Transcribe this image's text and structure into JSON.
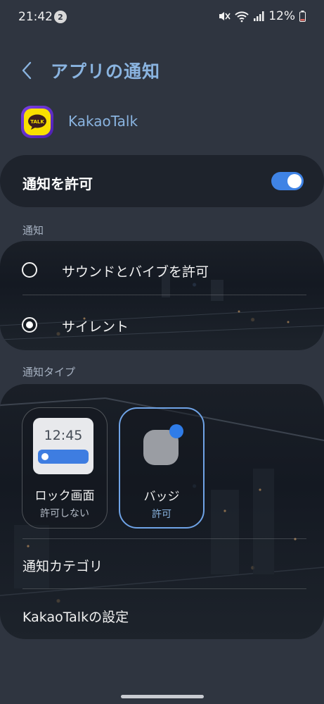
{
  "status_bar": {
    "time": "21:42",
    "notification_count": "2",
    "battery": "12%"
  },
  "header": {
    "title": "アプリの通知"
  },
  "app": {
    "name": "KakaoTalk",
    "icon_text": "TALK"
  },
  "allow": {
    "label": "通知を許可",
    "enabled": true
  },
  "notifications_section": {
    "label": "通知",
    "options": [
      {
        "label": "サウンドとバイブを許可",
        "selected": false
      },
      {
        "label": "サイレント",
        "selected": true
      }
    ]
  },
  "types_section": {
    "label": "通知タイプ",
    "tiles": [
      {
        "title": "ロック画面",
        "status": "許可しない",
        "preview_time": "12:45",
        "selected": false
      },
      {
        "title": "バッジ",
        "status": "許可",
        "selected": true
      }
    ],
    "menu": [
      {
        "label": "通知カテゴリ"
      },
      {
        "label": "KakaoTalkの設定"
      }
    ]
  },
  "colors": {
    "accent": "#3f83e5",
    "title_blue": "#8ab4e0",
    "background": "#2f3540",
    "card": "#1e232c"
  }
}
